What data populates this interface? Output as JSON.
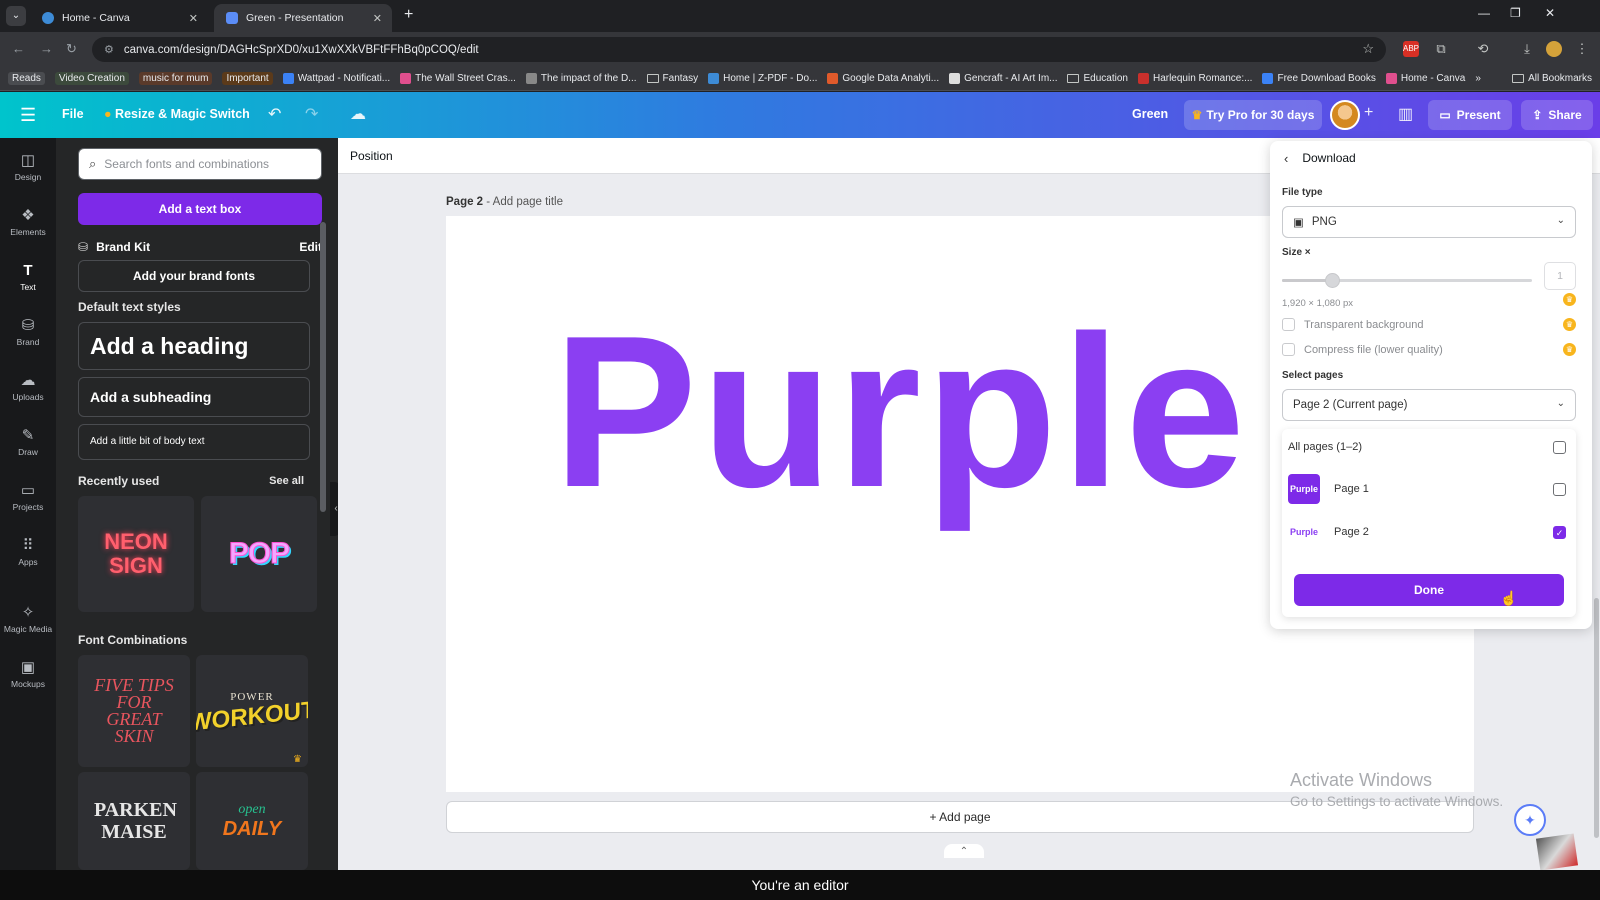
{
  "browser": {
    "tabs": [
      {
        "label": "Home - Canva",
        "active": false
      },
      {
        "label": "Green - Presentation",
        "active": true
      }
    ],
    "url": "canva.com/design/DAGHcSprXD0/xu1XwXXkVBFtFFhBq0pCOQ/edit",
    "bookmarks": [
      {
        "label": "Reads",
        "style": "pill",
        "color": "#4a4c50"
      },
      {
        "label": "Video Creation",
        "style": "pill",
        "color": "#3c4a3c"
      },
      {
        "label": "music for mum",
        "style": "pill",
        "color": "#5a3a2a"
      },
      {
        "label": "Important",
        "style": "pill",
        "color": "#5b3a1a"
      },
      {
        "label": "Wattpad - Notificati...",
        "icon": "wattpad-icon"
      },
      {
        "label": "The Wall Street Cras...",
        "icon": "h-icon"
      },
      {
        "label": "The impact of the D...",
        "icon": "doc-icon"
      },
      {
        "label": "Fantasy",
        "icon": "folder-icon"
      },
      {
        "label": "Home | Z-PDF - Do...",
        "icon": "z-icon"
      },
      {
        "label": "Google Data Analyti...",
        "icon": "coursera-icon"
      },
      {
        "label": "Gencraft - AI Art Im...",
        "icon": "gencraft-icon"
      },
      {
        "label": "Education",
        "icon": "folder-icon"
      },
      {
        "label": "Harlequin Romance:...",
        "icon": "harlequin-icon"
      },
      {
        "label": "Free Download Books",
        "icon": "book-icon"
      },
      {
        "label": "Home - Canva",
        "icon": "canva-icon"
      }
    ],
    "all_bookmarks": "All Bookmarks"
  },
  "canva_top": {
    "file": "File",
    "resize": "Resize & Magic Switch",
    "doc_title": "Green",
    "try_pro": "Try Pro for 30 days",
    "present": "Present",
    "share": "Share"
  },
  "rail": [
    {
      "label": "Design",
      "icon": "design-icon"
    },
    {
      "label": "Elements",
      "icon": "elements-icon"
    },
    {
      "label": "Text",
      "icon": "text-icon",
      "active": true
    },
    {
      "label": "Brand",
      "icon": "brand-icon"
    },
    {
      "label": "Uploads",
      "icon": "uploads-icon"
    },
    {
      "label": "Draw",
      "icon": "draw-icon"
    },
    {
      "label": "Projects",
      "icon": "projects-icon"
    },
    {
      "label": "Apps",
      "icon": "apps-icon"
    },
    {
      "label": "Magic Media",
      "icon": "magic-media-icon"
    },
    {
      "label": "Mockups",
      "icon": "mockups-icon"
    }
  ],
  "panel": {
    "search_placeholder": "Search fonts and combinations",
    "add_text_box": "Add a text box",
    "brand_kit": "Brand Kit",
    "edit": "Edit",
    "add_brand_fonts": "Add your brand fonts",
    "default_styles": "Default text styles",
    "heading": "Add a heading",
    "subheading": "Add a subheading",
    "body": "Add a little bit of body text",
    "recently_used": "Recently used",
    "see_all": "See all",
    "recent": [
      "NEON SIGN",
      "POP"
    ],
    "font_combinations": "Font Combinations",
    "combos": [
      "FIVE TIPS FOR GREAT SKIN",
      "POWER",
      "WORKOUT",
      "PARKEN MAISE",
      "open",
      "DAILY"
    ]
  },
  "canvas": {
    "position": "Position",
    "page_label": "Page 2",
    "page_title_placeholder": "- Add page title",
    "main_text": "Purple",
    "add_page": "+ Add page",
    "watermark_line1": "Activate Windows",
    "watermark_line2": "Go to Settings to activate Windows."
  },
  "download": {
    "title": "Download",
    "file_type_label": "File type",
    "file_type": "PNG",
    "size_label": "Size ×",
    "size_value": "1",
    "size_slider_fraction": 0.2,
    "dimensions": "1,920 × 1,080 px",
    "transparent": "Transparent background",
    "compress": "Compress file (lower quality)",
    "select_pages_label": "Select pages",
    "select_pages_value": "Page 2 (Current page)",
    "options": [
      {
        "label": "All pages (1–2)",
        "checked": false
      },
      {
        "label": "Page 1",
        "thumb": "Purple",
        "checked": false
      },
      {
        "label": "Page 2",
        "thumb": "Purple",
        "checked": true
      }
    ],
    "done": "Done"
  },
  "caption": "You're an editor",
  "colors": {
    "canva_purple": "#7d2ae8",
    "text_purple": "#8b3ff2",
    "crown_gold": "#f8b51d"
  }
}
